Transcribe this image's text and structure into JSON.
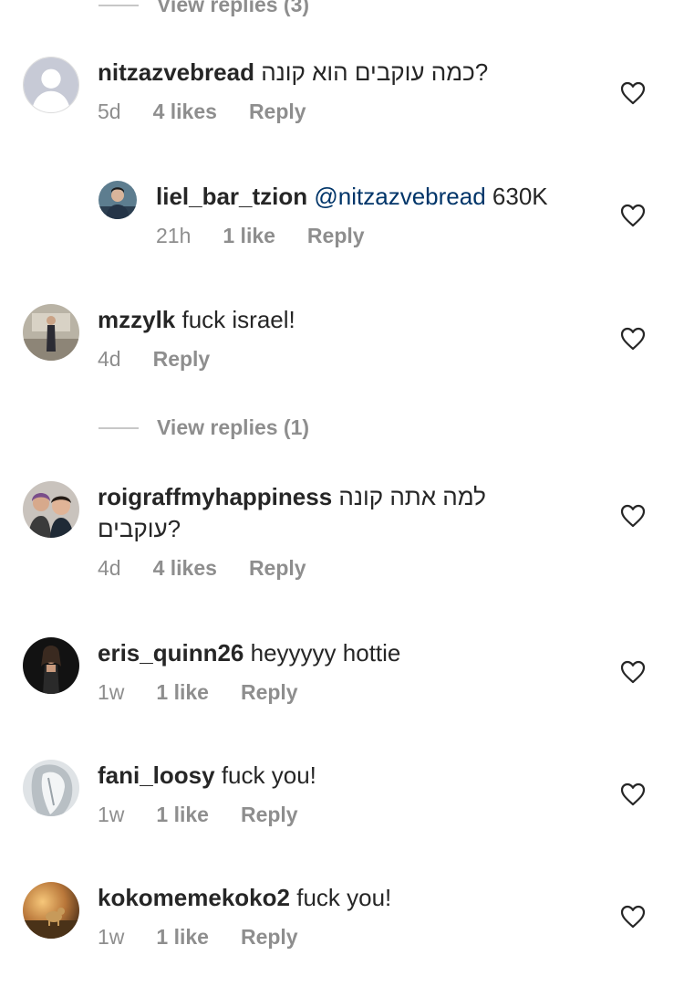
{
  "top_view_replies": "View replies (3)",
  "mid_view_replies": "View replies (1)",
  "comments": [
    {
      "username": "nitzazvebread",
      "text_rtl": "כמה עוקבים הוא קונה",
      "text_end": "?",
      "time": "5d",
      "likes": "4 likes",
      "reply": "Reply"
    },
    {
      "username": "liel_bar_tzion",
      "mention": "@nitzazvebread",
      "text": "630K",
      "time": "21h",
      "likes": "1 like",
      "reply": "Reply"
    },
    {
      "username": "mzzylk",
      "text": "fuck israel!",
      "time": "4d",
      "reply": "Reply"
    },
    {
      "username": "roigraffmyhappiness",
      "text_rtl": "למה אתה קונה",
      "text_rtl2": "עוקבים",
      "text_end": "?",
      "time": "4d",
      "likes": "4 likes",
      "reply": "Reply"
    },
    {
      "username": "eris_quinn26",
      "text": "heyyyyy hottie",
      "time": "1w",
      "likes": "1 like",
      "reply": "Reply"
    },
    {
      "username": "fani_loosy",
      "text": "fuck you!",
      "time": "1w",
      "likes": "1 like",
      "reply": "Reply"
    },
    {
      "username": "kokomemekoko2",
      "text": "fuck you!",
      "time": "1w",
      "likes": "1 like",
      "reply": "Reply"
    }
  ],
  "icons": {
    "like": "heart-outline-icon",
    "default_avatar": "default-avatar-icon"
  },
  "colors": {
    "text": "#262626",
    "meta": "#8e8e8e",
    "mention": "#003569"
  }
}
